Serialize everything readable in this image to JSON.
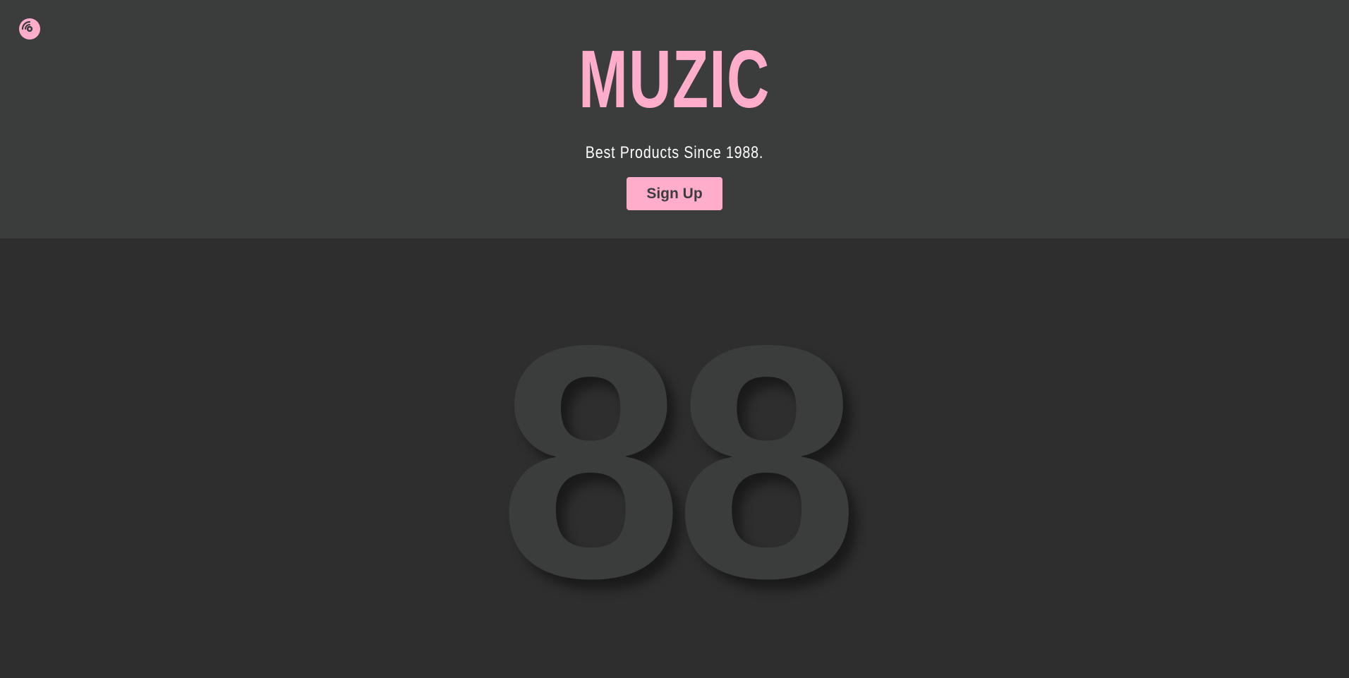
{
  "header": {
    "logo_icon": "vinyl-record-icon",
    "brand_title": "MUZIC",
    "tagline": "Best Products Since 1988.",
    "signup_label": "Sign Up"
  },
  "feature": {
    "big_number": "88"
  },
  "colors": {
    "accent": "#ffadcb",
    "header_bg": "#3b3c3c",
    "section_bg": "#2e2e2e",
    "number_fill": "#3b3c3c"
  }
}
